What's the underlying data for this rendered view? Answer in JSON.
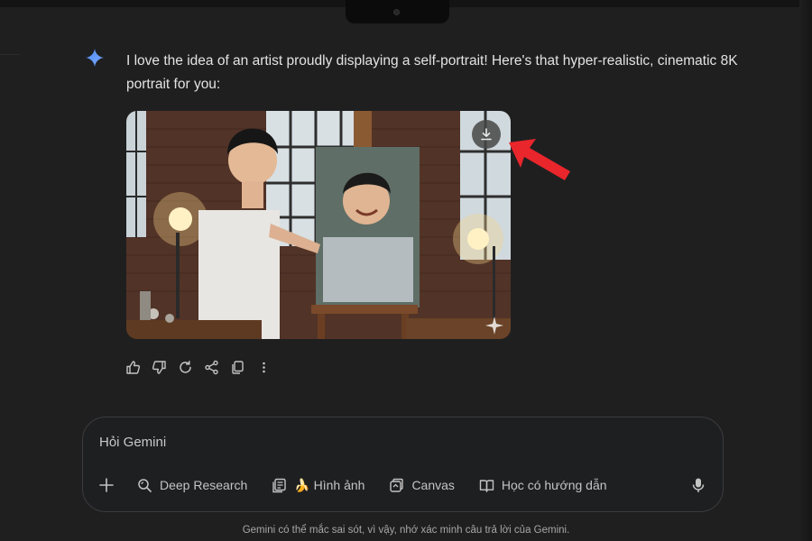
{
  "response": {
    "text": "I love the idea of an artist proudly displaying a self-portrait! Here's that hyper-realistic, cinematic 8K portrait for you:",
    "icon": "gemini-sparkle-icon",
    "image": {
      "icon": "download-icon"
    }
  },
  "actions": [
    {
      "icon": "thumbs-up-icon"
    },
    {
      "icon": "thumbs-down-icon"
    },
    {
      "icon": "regenerate-icon"
    },
    {
      "icon": "share-icon"
    },
    {
      "icon": "copy-icon"
    },
    {
      "icon": "more-vert-icon"
    }
  ],
  "composer": {
    "placeholder": "Hỏi Gemini",
    "tools": [
      {
        "label": "Deep Research",
        "icon": "deep-research-icon"
      },
      {
        "label": "🍌 Hình ảnh",
        "icon": "image-icon"
      },
      {
        "label": "Canvas",
        "icon": "canvas-icon"
      },
      {
        "label": "Học có hướng dẫn",
        "icon": "guided-learning-icon"
      }
    ],
    "mic_icon": "mic-icon",
    "plus_icon": "plus-icon"
  },
  "footer": {
    "disclaimer": "Gemini có thể mắc sai sót, vì vậy, nhớ xác minh câu trả lời của Gemini."
  },
  "colors": {
    "background": "#1f1f20",
    "accent_sparkle": "#4f8ef7",
    "annotation_arrow": "#e8262c"
  }
}
